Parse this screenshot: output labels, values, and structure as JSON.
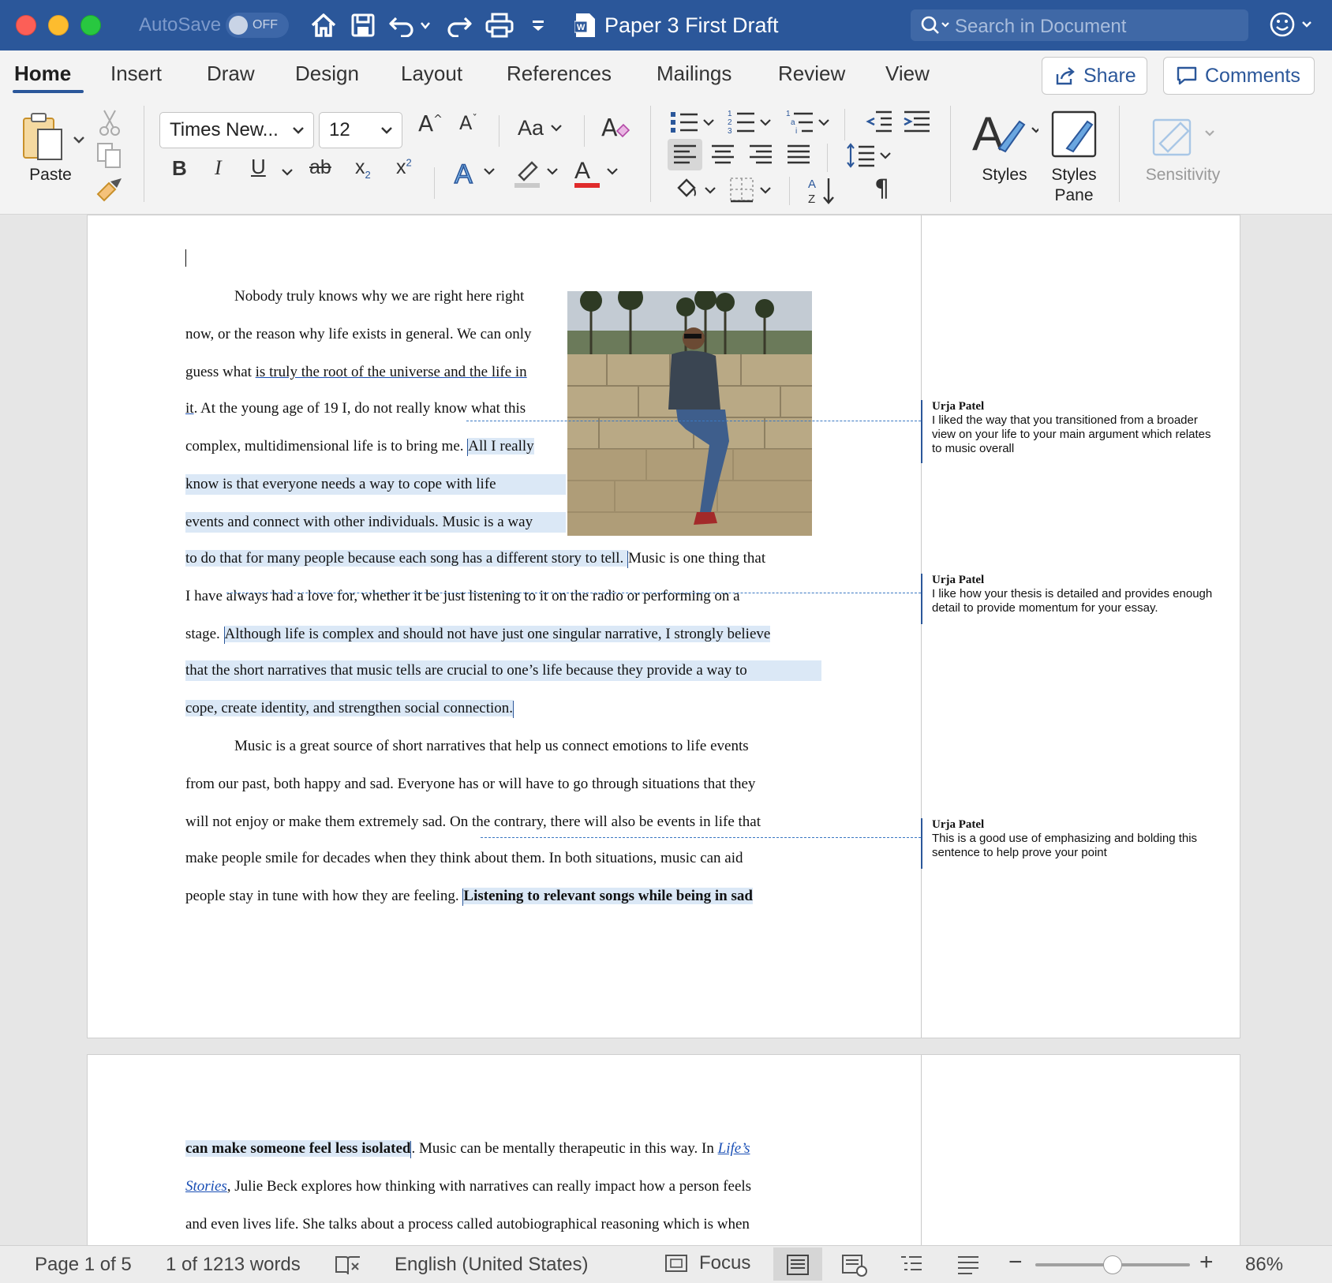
{
  "window": {
    "autosave_label": "AutoSave",
    "autosave_state": "OFF",
    "doc_title": "Paper 3 First Draft",
    "search_placeholder": "Search in Document"
  },
  "tabs": [
    "Home",
    "Insert",
    "Draw",
    "Design",
    "Layout",
    "References",
    "Mailings",
    "Review",
    "View"
  ],
  "active_tab": "Home",
  "actions": {
    "share": "Share",
    "comments": "Comments"
  },
  "ribbon": {
    "paste": "Paste",
    "font_name": "Times New...",
    "font_size": "12",
    "change_case": "Aa",
    "styles": "Styles",
    "styles_pane_1": "Styles",
    "styles_pane_2": "Pane",
    "sensitivity": "Sensitivity"
  },
  "document": {
    "p1_l1": "Nobody truly knows why we are right here right",
    "p1_l2": "now, or the reason why life exists in general. We can only",
    "p1_l3a": "guess what ",
    "p1_l3b": "is truly the root of the universe and the life in ",
    "p1_l4a": "it",
    "p1_l4b": ". At the young age of 19 I, do not really know what this",
    "p1_l5a": "complex, multidimensional life is to bring me. ",
    "p1_l5b": "All I really",
    "p1_l6": "know is that everyone needs a way to cope with life",
    "p1_l7": "events and connect with other individuals. Music is a way",
    "p1_l8a": "to do that for many people because each song has a different story to tell. ",
    "p1_l8b": "Music is one thing that",
    "p1_l9": "I have always had a love for, whether it be just listening to it on the radio or performing on a",
    "p1_l10a": "stage. ",
    "p1_l10b": "Although life is complex and should not have just one singular narrative, I strongly believe",
    "p1_l11": "that the short narratives that music tells are crucial to one’s life because they provide a way to",
    "p1_l12": "cope, create identity, and strengthen social connection.",
    "p2_l1": "Music is a great source of short narratives that help us connect emotions to life events",
    "p2_l2": "from our past, both happy and sad. Everyone has or will have to go through situations that they",
    "p2_l3": "will not enjoy or make them extremely sad. On the contrary, there will also be events in life that",
    "p2_l4": "make people smile for decades when they think about them. In both situations, music can aid",
    "p2_l5a": "people stay in tune with how they are feeling. ",
    "p2_l5b": "Listening to relevant songs while being in sad",
    "pg2_l1a": "can make someone feel less isolated",
    "pg2_l1b": ". Music can be mentally therapeutic in this way. In ",
    "pg2_l1c": "Life’s",
    "pg2_l2a": "Stories",
    "pg2_l2b": ", Julie Beck explores how thinking with narratives can really impact how a person feels",
    "pg2_l3": "and even lives life. She talks about a process called autobiographical reasoning which is when"
  },
  "comments": [
    {
      "author": "Urja Patel",
      "text": "I liked the way that you transitioned from a broader view on your life to your main argument which relates to music overall"
    },
    {
      "author": "Urja Patel",
      "text": "I like how your thesis is detailed and provides enough detail to provide momentum for your essay."
    },
    {
      "author": "Urja Patel",
      "text": "This is a good use of emphasizing and bolding this sentence to help prove your point"
    }
  ],
  "status": {
    "page": "Page 1 of 5",
    "words": "1 of 1213 words",
    "language": "English (United States)",
    "focus": "Focus",
    "zoom": "86%"
  },
  "colors": {
    "brand": "#2b579a",
    "highlight": "#dbe8f6",
    "font_color": "#e02b2b"
  }
}
